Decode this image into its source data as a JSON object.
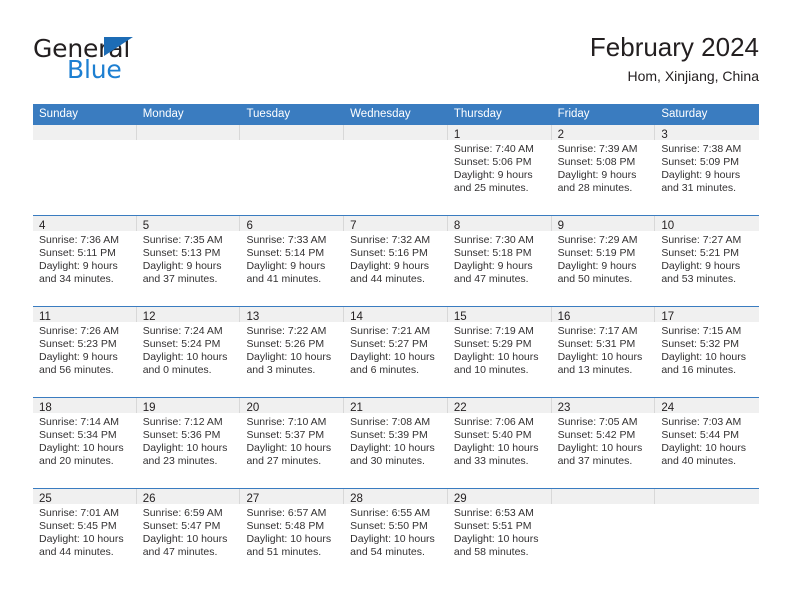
{
  "branding": {
    "logo_primary": "General",
    "logo_secondary": "Blue",
    "accent_color": "#1d7fd1",
    "header_bar_color": "#3a7cc0"
  },
  "header": {
    "title": "February 2024",
    "subtitle": "Hom, Xinjiang, China"
  },
  "weekdays": [
    "Sunday",
    "Monday",
    "Tuesday",
    "Wednesday",
    "Thursday",
    "Friday",
    "Saturday"
  ],
  "weeks": [
    [
      {
        "day": "",
        "empty": true
      },
      {
        "day": "",
        "empty": true
      },
      {
        "day": "",
        "empty": true
      },
      {
        "day": "",
        "empty": true
      },
      {
        "day": "1",
        "sunrise": "Sunrise: 7:40 AM",
        "sunset": "Sunset: 5:06 PM",
        "daylight1": "Daylight: 9 hours",
        "daylight2": "and 25 minutes."
      },
      {
        "day": "2",
        "sunrise": "Sunrise: 7:39 AM",
        "sunset": "Sunset: 5:08 PM",
        "daylight1": "Daylight: 9 hours",
        "daylight2": "and 28 minutes."
      },
      {
        "day": "3",
        "sunrise": "Sunrise: 7:38 AM",
        "sunset": "Sunset: 5:09 PM",
        "daylight1": "Daylight: 9 hours",
        "daylight2": "and 31 minutes."
      }
    ],
    [
      {
        "day": "4",
        "sunrise": "Sunrise: 7:36 AM",
        "sunset": "Sunset: 5:11 PM",
        "daylight1": "Daylight: 9 hours",
        "daylight2": "and 34 minutes."
      },
      {
        "day": "5",
        "sunrise": "Sunrise: 7:35 AM",
        "sunset": "Sunset: 5:13 PM",
        "daylight1": "Daylight: 9 hours",
        "daylight2": "and 37 minutes."
      },
      {
        "day": "6",
        "sunrise": "Sunrise: 7:33 AM",
        "sunset": "Sunset: 5:14 PM",
        "daylight1": "Daylight: 9 hours",
        "daylight2": "and 41 minutes."
      },
      {
        "day": "7",
        "sunrise": "Sunrise: 7:32 AM",
        "sunset": "Sunset: 5:16 PM",
        "daylight1": "Daylight: 9 hours",
        "daylight2": "and 44 minutes."
      },
      {
        "day": "8",
        "sunrise": "Sunrise: 7:30 AM",
        "sunset": "Sunset: 5:18 PM",
        "daylight1": "Daylight: 9 hours",
        "daylight2": "and 47 minutes."
      },
      {
        "day": "9",
        "sunrise": "Sunrise: 7:29 AM",
        "sunset": "Sunset: 5:19 PM",
        "daylight1": "Daylight: 9 hours",
        "daylight2": "and 50 minutes."
      },
      {
        "day": "10",
        "sunrise": "Sunrise: 7:27 AM",
        "sunset": "Sunset: 5:21 PM",
        "daylight1": "Daylight: 9 hours",
        "daylight2": "and 53 minutes."
      }
    ],
    [
      {
        "day": "11",
        "sunrise": "Sunrise: 7:26 AM",
        "sunset": "Sunset: 5:23 PM",
        "daylight1": "Daylight: 9 hours",
        "daylight2": "and 56 minutes."
      },
      {
        "day": "12",
        "sunrise": "Sunrise: 7:24 AM",
        "sunset": "Sunset: 5:24 PM",
        "daylight1": "Daylight: 10 hours",
        "daylight2": "and 0 minutes."
      },
      {
        "day": "13",
        "sunrise": "Sunrise: 7:22 AM",
        "sunset": "Sunset: 5:26 PM",
        "daylight1": "Daylight: 10 hours",
        "daylight2": "and 3 minutes."
      },
      {
        "day": "14",
        "sunrise": "Sunrise: 7:21 AM",
        "sunset": "Sunset: 5:27 PM",
        "daylight1": "Daylight: 10 hours",
        "daylight2": "and 6 minutes."
      },
      {
        "day": "15",
        "sunrise": "Sunrise: 7:19 AM",
        "sunset": "Sunset: 5:29 PM",
        "daylight1": "Daylight: 10 hours",
        "daylight2": "and 10 minutes."
      },
      {
        "day": "16",
        "sunrise": "Sunrise: 7:17 AM",
        "sunset": "Sunset: 5:31 PM",
        "daylight1": "Daylight: 10 hours",
        "daylight2": "and 13 minutes."
      },
      {
        "day": "17",
        "sunrise": "Sunrise: 7:15 AM",
        "sunset": "Sunset: 5:32 PM",
        "daylight1": "Daylight: 10 hours",
        "daylight2": "and 16 minutes."
      }
    ],
    [
      {
        "day": "18",
        "sunrise": "Sunrise: 7:14 AM",
        "sunset": "Sunset: 5:34 PM",
        "daylight1": "Daylight: 10 hours",
        "daylight2": "and 20 minutes."
      },
      {
        "day": "19",
        "sunrise": "Sunrise: 7:12 AM",
        "sunset": "Sunset: 5:36 PM",
        "daylight1": "Daylight: 10 hours",
        "daylight2": "and 23 minutes."
      },
      {
        "day": "20",
        "sunrise": "Sunrise: 7:10 AM",
        "sunset": "Sunset: 5:37 PM",
        "daylight1": "Daylight: 10 hours",
        "daylight2": "and 27 minutes."
      },
      {
        "day": "21",
        "sunrise": "Sunrise: 7:08 AM",
        "sunset": "Sunset: 5:39 PM",
        "daylight1": "Daylight: 10 hours",
        "daylight2": "and 30 minutes."
      },
      {
        "day": "22",
        "sunrise": "Sunrise: 7:06 AM",
        "sunset": "Sunset: 5:40 PM",
        "daylight1": "Daylight: 10 hours",
        "daylight2": "and 33 minutes."
      },
      {
        "day": "23",
        "sunrise": "Sunrise: 7:05 AM",
        "sunset": "Sunset: 5:42 PM",
        "daylight1": "Daylight: 10 hours",
        "daylight2": "and 37 minutes."
      },
      {
        "day": "24",
        "sunrise": "Sunrise: 7:03 AM",
        "sunset": "Sunset: 5:44 PM",
        "daylight1": "Daylight: 10 hours",
        "daylight2": "and 40 minutes."
      }
    ],
    [
      {
        "day": "25",
        "sunrise": "Sunrise: 7:01 AM",
        "sunset": "Sunset: 5:45 PM",
        "daylight1": "Daylight: 10 hours",
        "daylight2": "and 44 minutes."
      },
      {
        "day": "26",
        "sunrise": "Sunrise: 6:59 AM",
        "sunset": "Sunset: 5:47 PM",
        "daylight1": "Daylight: 10 hours",
        "daylight2": "and 47 minutes."
      },
      {
        "day": "27",
        "sunrise": "Sunrise: 6:57 AM",
        "sunset": "Sunset: 5:48 PM",
        "daylight1": "Daylight: 10 hours",
        "daylight2": "and 51 minutes."
      },
      {
        "day": "28",
        "sunrise": "Sunrise: 6:55 AM",
        "sunset": "Sunset: 5:50 PM",
        "daylight1": "Daylight: 10 hours",
        "daylight2": "and 54 minutes."
      },
      {
        "day": "29",
        "sunrise": "Sunrise: 6:53 AM",
        "sunset": "Sunset: 5:51 PM",
        "daylight1": "Daylight: 10 hours",
        "daylight2": "and 58 minutes."
      },
      {
        "day": "",
        "empty": true
      },
      {
        "day": "",
        "empty": true
      }
    ]
  ]
}
